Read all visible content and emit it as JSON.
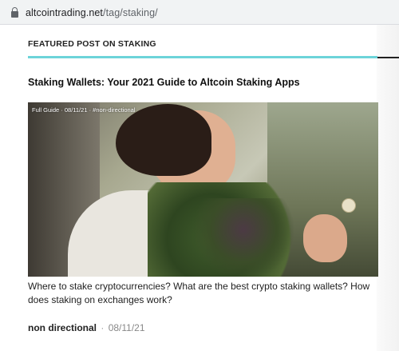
{
  "browser": {
    "url_host": "altcointrading.net",
    "url_path": "/tag/staking/"
  },
  "section": {
    "title": "FEATURED POST ON STAKING"
  },
  "post": {
    "title": "Staking Wallets: Your 2021 Guide to Altcoin Staking Apps",
    "image_overlay": "Full Guide · 08/11/21 · #non-directional",
    "excerpt": "Where to stake cryptocurrencies? What are the best crypto staking wallets? How does staking on exchanges work?",
    "author": "non directional",
    "separator": "·",
    "date": "08/11/21"
  },
  "colors": {
    "accent_rule": "#6dd4d9"
  }
}
